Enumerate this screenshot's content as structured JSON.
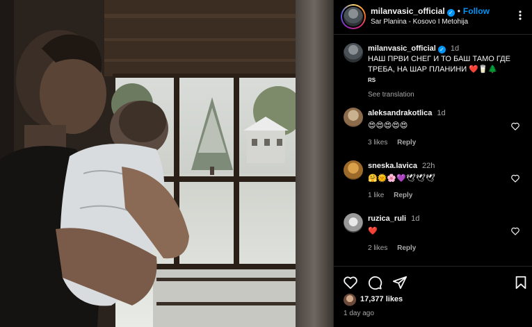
{
  "post": {
    "username": "milanvasic_official",
    "follow_label": "Follow",
    "location": "Sar Planina - Kosovo I Metohija",
    "caption": "НАШ ПРВИ СНЕГ И ТО БАШ ТАМО ГДЕ ТРЕБА, НА ШАР ПЛАНИНИ ❤️🥛🌲",
    "caption_flag": "RS",
    "caption_time": "1d",
    "see_translation": "See translation"
  },
  "comments": [
    {
      "username": "aleksandrakotlica",
      "time": "1d",
      "text": "😍😍😍😍😍",
      "likes": "3 likes",
      "reply": "Reply"
    },
    {
      "username": "sneska.lavica",
      "time": "22h",
      "text": "🤗🌞🌸💜🕊🕊🕊",
      "likes": "1 like",
      "reply": "Reply"
    },
    {
      "username": "ruzica_ruli",
      "time": "1d",
      "text": "❤️",
      "likes": "2 likes",
      "reply": "Reply"
    }
  ],
  "footer": {
    "likes_count": "17,377 likes",
    "time_ago": "1 day ago"
  },
  "icons": {
    "verified": "verified-badge-icon",
    "more": "more-options-icon",
    "like": "heart-icon",
    "comment": "comment-icon",
    "share": "share-icon",
    "save": "bookmark-icon"
  },
  "colors": {
    "accent": "#0095f6",
    "heart": "#ed4956",
    "muted": "#a8a8a8"
  }
}
